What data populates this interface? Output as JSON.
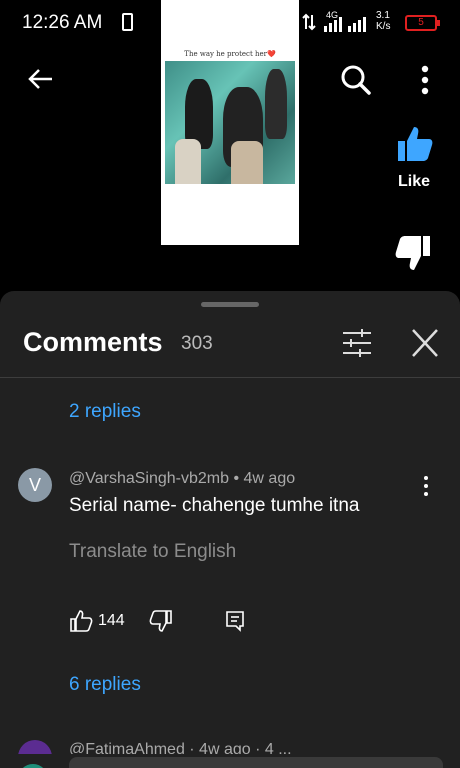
{
  "status_bar": {
    "time": "12:26 AM",
    "network_type": "4G",
    "speed_value": "3.1",
    "speed_unit": "K/s",
    "battery": "5"
  },
  "video": {
    "caption": "The way he protect her❤️",
    "back_icon": "arrow-left-icon",
    "search_icon": "search-icon",
    "more_icon": "more-vert-icon"
  },
  "actions": {
    "like_label": "Like",
    "dislike_label": "Dislike",
    "like_color": "#3ea6ff"
  },
  "comments": {
    "title": "Comments",
    "count": "303",
    "top_replies": "2 replies",
    "comment": {
      "avatar_letter": "V",
      "author": "@VarshaSingh-vb2mb",
      "time": "4w ago",
      "text": "Serial name- chahenge tumhe itna",
      "translate": "Translate to English",
      "likes": "144",
      "replies": "6 replies"
    },
    "next_author": "@FatimaAhmed · 4w ago · 4 ..."
  },
  "colors": {
    "sheet_bg": "#212121",
    "link": "#3ea6ff",
    "muted": "#aaaaaa"
  }
}
